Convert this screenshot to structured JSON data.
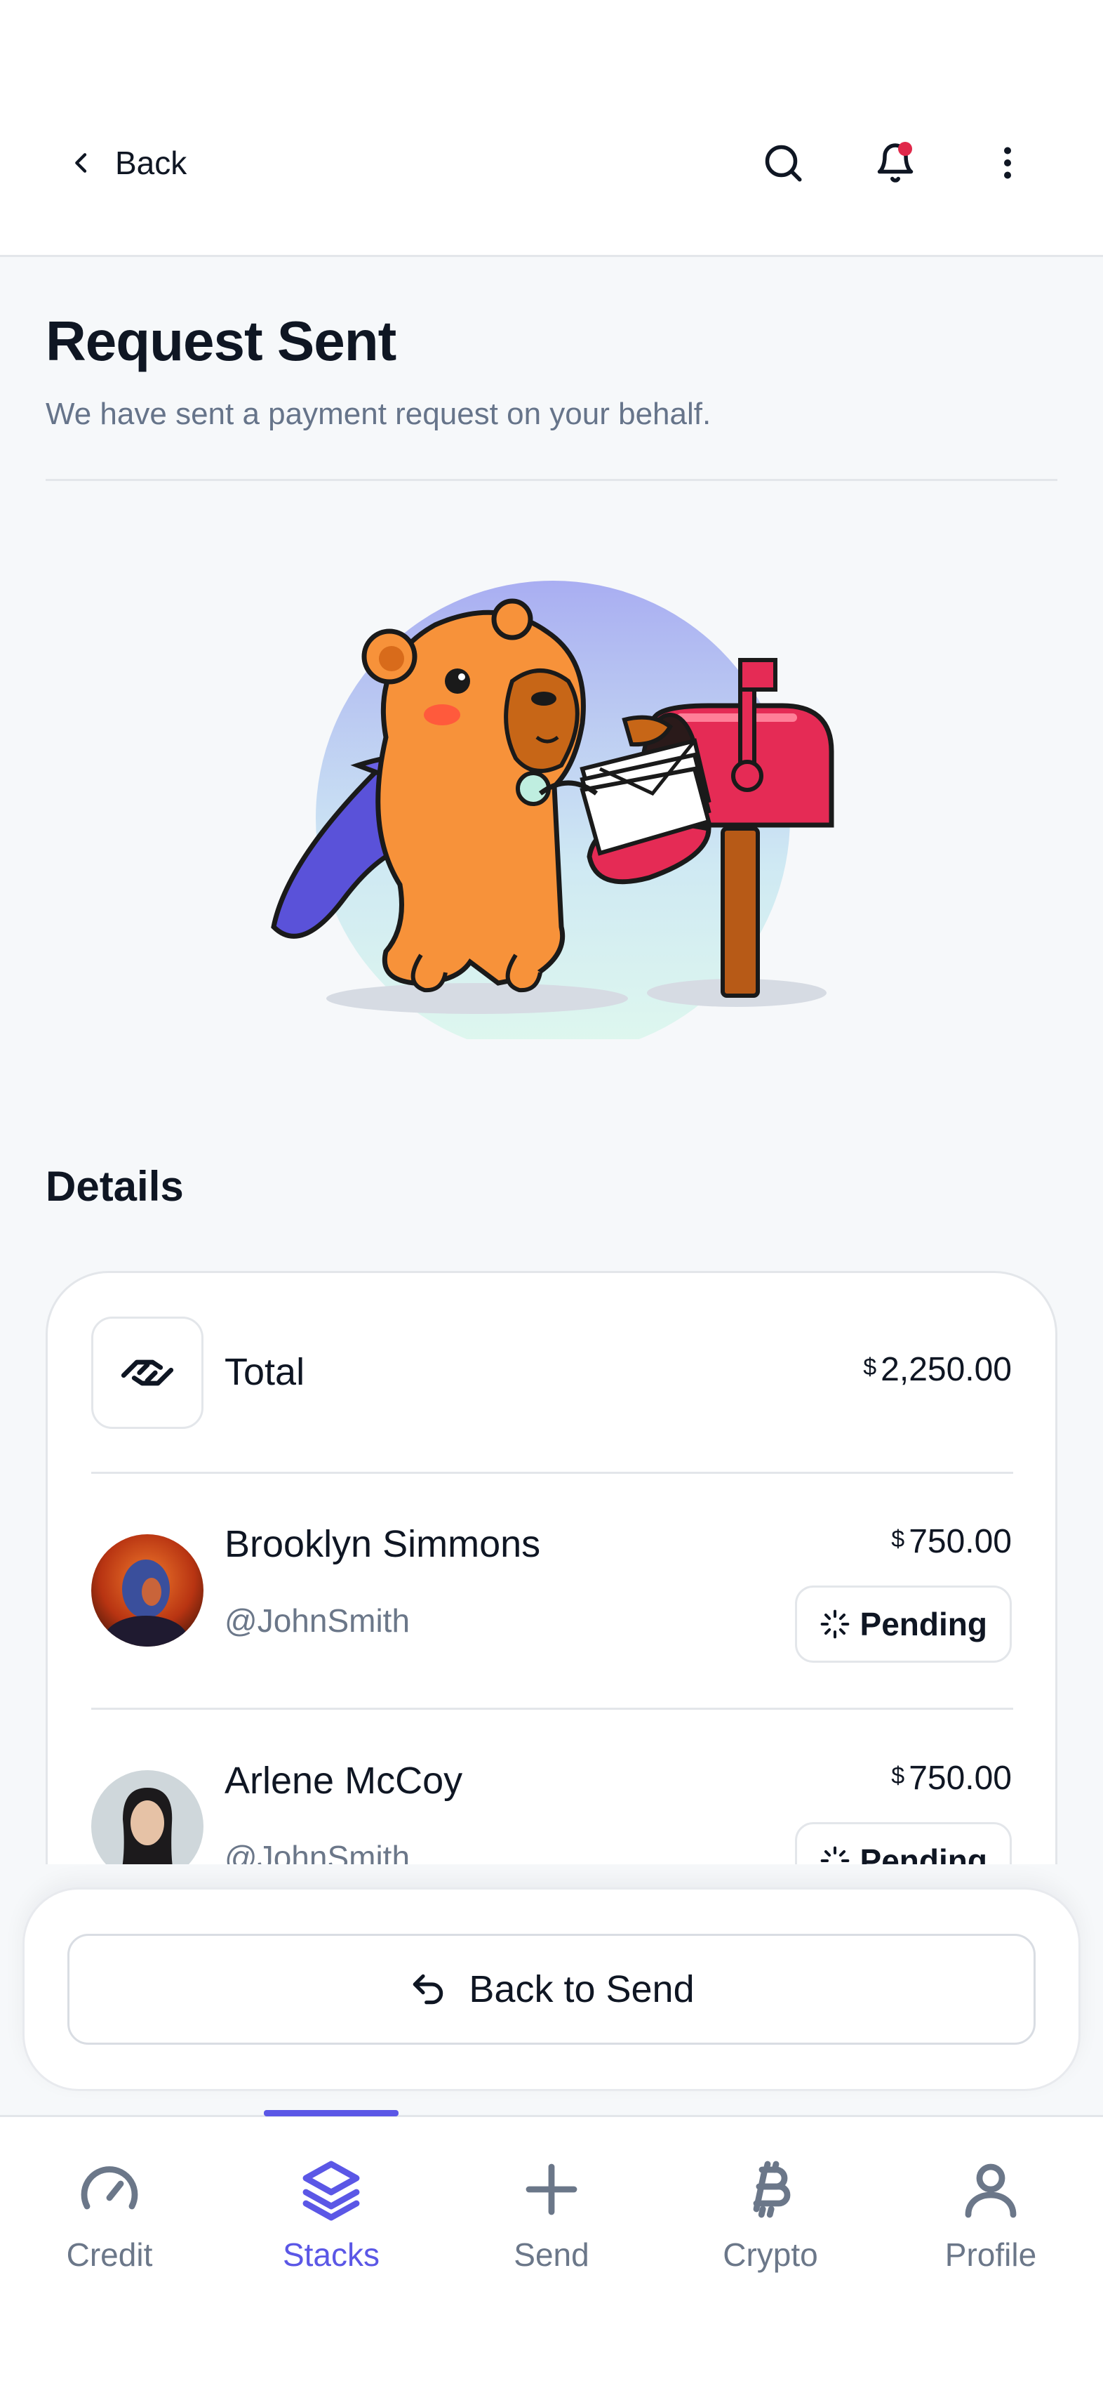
{
  "header": {
    "back_label": "Back"
  },
  "page": {
    "title": "Request Sent",
    "subtitle": "We have sent a payment request on your behalf."
  },
  "details": {
    "heading": "Details",
    "total": {
      "label": "Total",
      "currency": "$",
      "amount": "2,250.00"
    },
    "recipients": [
      {
        "name": "Brooklyn Simmons",
        "handle": "@JohnSmith",
        "currency": "$",
        "amount": "750.00",
        "status": "Pending"
      },
      {
        "name": "Arlene McCoy",
        "handle": "@JohnSmith",
        "currency": "$",
        "amount": "750.00",
        "status": "Pending"
      }
    ]
  },
  "footer": {
    "button_label": "Back to Send"
  },
  "tabs": [
    {
      "label": "Credit",
      "icon": "gauge-icon"
    },
    {
      "label": "Stacks",
      "icon": "layers-icon",
      "active": true
    },
    {
      "label": "Send",
      "icon": "plus-icon"
    },
    {
      "label": "Crypto",
      "icon": "bitcoin-icon"
    },
    {
      "label": "Profile",
      "icon": "user-icon"
    }
  ],
  "colors": {
    "accent": "#5b57e6",
    "notification_dot": "#e0284a",
    "text_primary": "#0f1623",
    "text_secondary": "#66748a"
  }
}
